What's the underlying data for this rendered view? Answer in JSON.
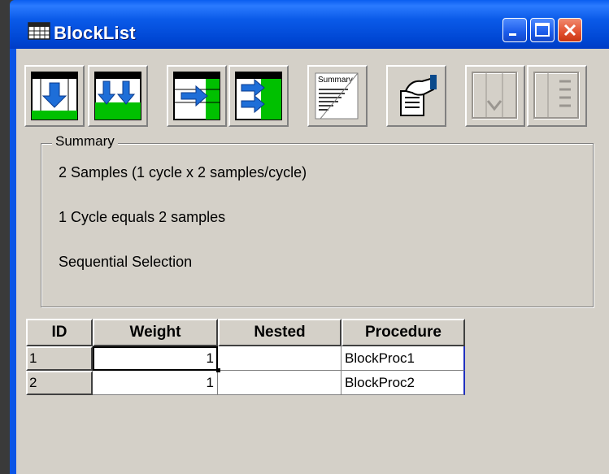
{
  "window": {
    "title": "BlockList",
    "title_icon": "table-icon",
    "controls": [
      "minimize-icon",
      "maximize-icon",
      "close-icon"
    ],
    "accent": "#0a5ae8"
  },
  "toolbar": {
    "buttons": [
      {
        "name": "insert-row-icon",
        "enabled": true
      },
      {
        "name": "insert-multiple-rows-icon",
        "enabled": true
      },
      {
        "name": "append-row-icon",
        "enabled": true
      },
      {
        "name": "append-multiple-rows-icon",
        "enabled": true
      },
      {
        "name": "summary-icon",
        "label": "Summary",
        "enabled": true
      },
      {
        "name": "properties-hand-icon",
        "enabled": true
      },
      {
        "name": "disabled-column-down-icon",
        "enabled": false
      },
      {
        "name": "disabled-column-list-icon",
        "enabled": false
      }
    ]
  },
  "summary": {
    "legend": "Summary",
    "lines": [
      "2 Samples (1 cycle x 2 samples/cycle)",
      "1 Cycle equals 2 samples",
      "Sequential Selection"
    ]
  },
  "grid": {
    "headers": [
      "ID",
      "Weight",
      "Nested",
      "Procedure"
    ],
    "rows": [
      {
        "id": "1",
        "weight": "1",
        "nested": "",
        "procedure": "BlockProc1"
      },
      {
        "id": "2",
        "weight": "1",
        "nested": "",
        "procedure": "BlockProc2"
      }
    ],
    "focused_cell": "row 1, Weight"
  }
}
